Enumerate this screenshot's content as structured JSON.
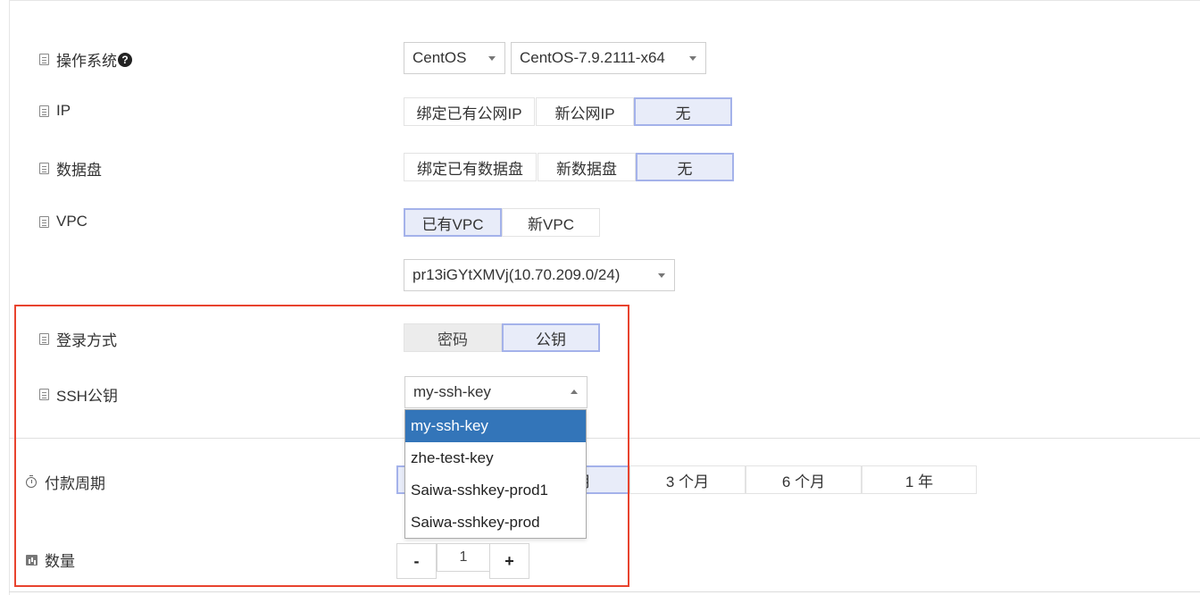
{
  "form": {
    "os": {
      "label": "操作系统",
      "help_icon_glyph": "?",
      "distro": "CentOS",
      "version": "CentOS-7.9.2111-x64"
    },
    "ip": {
      "label": "IP",
      "options": [
        "绑定已有公网IP",
        "新公网IP",
        "无"
      ],
      "selected": "无"
    },
    "data_disk": {
      "label": "数据盘",
      "options": [
        "绑定已有数据盘",
        "新数据盘",
        "无"
      ],
      "selected": "无"
    },
    "vpc": {
      "label": "VPC",
      "options": [
        "已有VPC",
        "新VPC"
      ],
      "selected": "已有VPC",
      "subnet": "pr13iGYtXMVj(10.70.209.0/24)"
    },
    "login": {
      "label": "登录方式",
      "options": [
        "密码",
        "公钥"
      ],
      "selected": "公钥"
    },
    "ssh_key": {
      "label": "SSH公钥",
      "value": "my-ssh-key",
      "options": [
        "my-ssh-key",
        "zhe-test-key",
        "Saiwa-sshkey-prod1",
        "Saiwa-sshkey-prod"
      ],
      "highlighted": "my-ssh-key"
    },
    "payment": {
      "label": "付款周期",
      "options": [
        "月",
        "3 个月",
        "6 个月",
        "1 年"
      ]
    },
    "quantity": {
      "label": "数量",
      "minus": "-",
      "value": "1",
      "plus": "+"
    }
  },
  "colors": {
    "highlight_border": "#e8432e",
    "active_segment_bg": "#e8ecf9",
    "active_segment_border": "#a4b2ea",
    "dropdown_selected": "#3375b9"
  },
  "icons": {
    "label_icon": "document-list-icon",
    "payment_icon": "clock-icon",
    "quantity_icon": "bar-chart-icon",
    "help_icon": "question-circle-icon",
    "caret": "caret-down-icon"
  }
}
